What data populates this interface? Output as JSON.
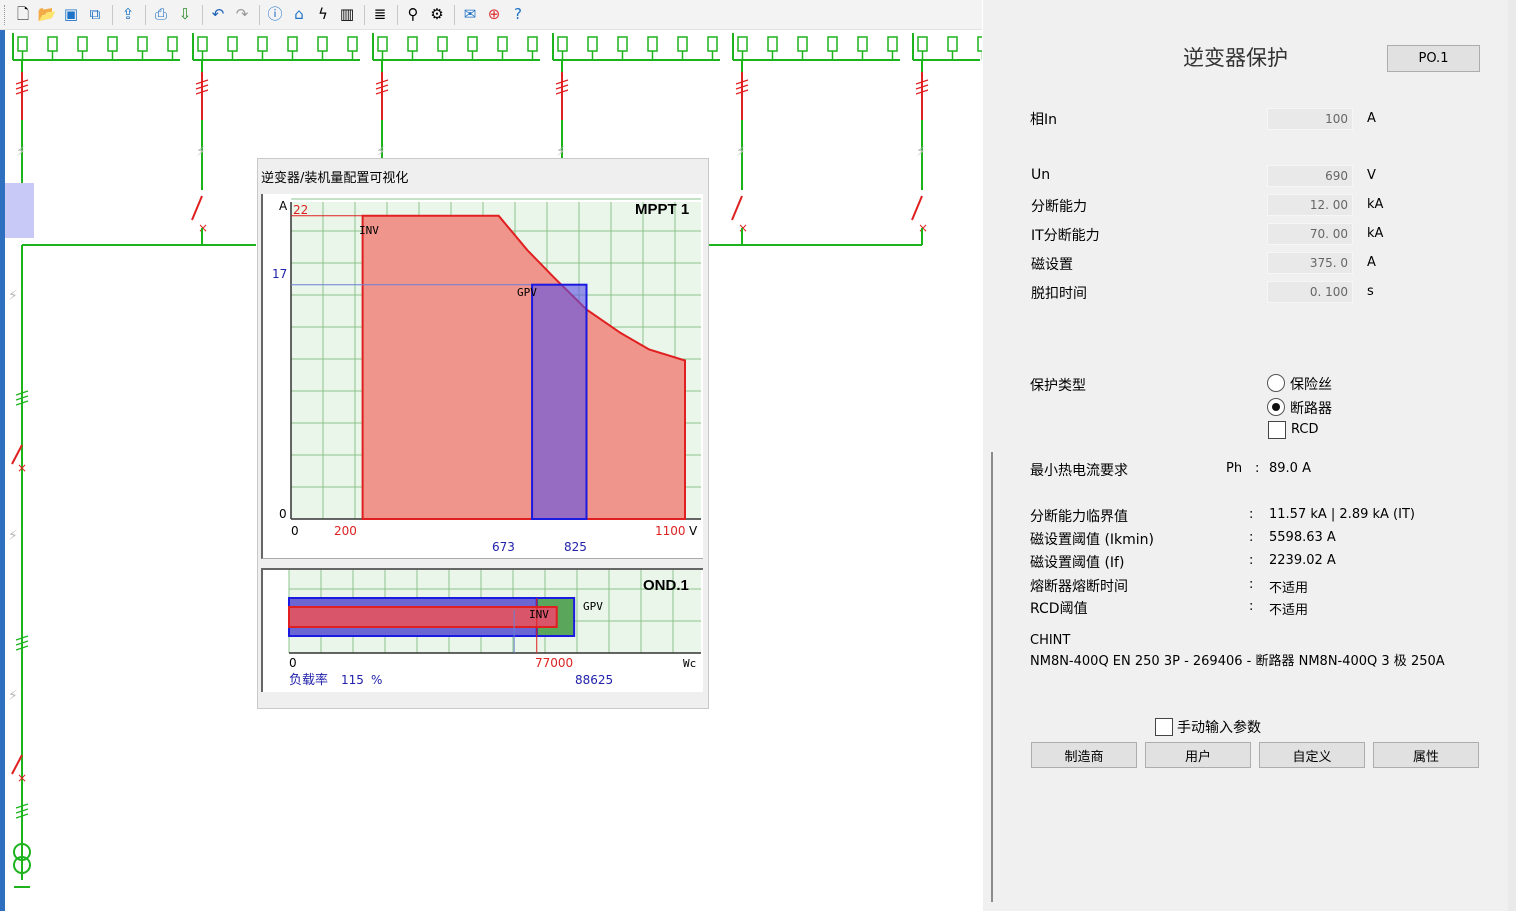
{
  "toolbar": {
    "icons": [
      "new-file-icon",
      "open-folder-icon",
      "save-icon",
      "save-all-icon",
      "export-icon",
      "print-icon",
      "export-dwg-icon",
      "undo-icon",
      "redo-icon",
      "info-icon",
      "home-icon",
      "lightning-icon",
      "bar-chart-icon",
      "database-icon",
      "wrench-icon",
      "gear-icon",
      "envelope-icon",
      "lifebuoy-icon",
      "help-icon"
    ]
  },
  "viz": {
    "title": "逆变器/装机量配置可视化",
    "mppt": {
      "name": "MPPT 1",
      "y_axis_unit": "A",
      "x_axis_unit": "V",
      "y_ticks": [
        "22",
        "17",
        "0"
      ],
      "x_ticks": [
        "0",
        "200",
        "1100"
      ],
      "gpv_x_ticks": [
        "673",
        "825"
      ],
      "inv_label": "INV",
      "gpv_label": "GPV"
    },
    "ond": {
      "name": "OND.1",
      "x_ticks": [
        "0",
        "77000",
        "88625"
      ],
      "x_unit": "Wc",
      "inv_label": "INV",
      "gpv_label": "GPV",
      "load_rate_label": "负载率",
      "load_rate_value": "115",
      "load_rate_unit": "%"
    }
  },
  "chart_data": [
    {
      "type": "area",
      "title": "MPPT 1",
      "xlabel": "V",
      "ylabel": "A",
      "xlim": [
        0,
        1100
      ],
      "ylim": [
        0,
        23
      ],
      "series": [
        {
          "name": "INV",
          "x": [
            200,
            200,
            580,
            660,
            735,
            825,
            920,
            1000,
            1100,
            1100
          ],
          "y": [
            0,
            22,
            22,
            19.5,
            17.5,
            15.2,
            13.5,
            12.3,
            11.5,
            0
          ]
        },
        {
          "name": "GPV",
          "x": [
            673,
            673,
            825,
            825
          ],
          "y": [
            0,
            17,
            17,
            0
          ]
        }
      ]
    },
    {
      "type": "bar",
      "title": "OND.1",
      "xlabel": "Wc",
      "xlim": [
        0,
        115000
      ],
      "series": [
        {
          "name": "INV",
          "values": [
            77000
          ]
        },
        {
          "name": "GPV",
          "values": [
            88625
          ]
        }
      ]
    }
  ],
  "panel": {
    "title": "逆变器保护",
    "id_button": "PO.1",
    "params": [
      {
        "label": "相In",
        "value": "100",
        "unit": "A"
      },
      {
        "label": "Un",
        "value": "690",
        "unit": "V"
      },
      {
        "label": "分断能力",
        "value": "12. 00",
        "unit": "kA"
      },
      {
        "label": "IT分断能力",
        "value": "70. 00",
        "unit": "kA"
      },
      {
        "label": "磁设置",
        "value": "375. 0",
        "unit": "A"
      },
      {
        "label": "脱扣时间",
        "value": "0. 100",
        "unit": "s"
      }
    ],
    "protection_type_label": "保护类型",
    "options": {
      "fuse": "保险丝",
      "breaker": "断路器",
      "rcd": "RCD"
    },
    "selected": "breaker",
    "min_current_label": "最小热电流要求",
    "ph_label": "Ph",
    "ph_value": "89.0 A",
    "results": [
      {
        "label": "分断能力临界值",
        "value": "11.57 kA  |  2.89 kA (IT)"
      },
      {
        "label": "磁设置阈值 (Ikmin)",
        "value": "5598.63 A"
      },
      {
        "label": "磁设置阈值 (If)",
        "value": "2239.02 A"
      },
      {
        "label": "熔断器熔断时间",
        "value": "不适用"
      },
      {
        "label": "RCD阈值",
        "value": "不适用"
      }
    ],
    "manufacturer": "CHINT",
    "model": "NM8N-400Q EN 250 3P - 269406 - 断路器  NM8N-400Q 3 极 250A",
    "manual_input_label": "手动输入参数",
    "buttons": [
      "制造商",
      "用户",
      "自定义",
      "属性"
    ]
  }
}
